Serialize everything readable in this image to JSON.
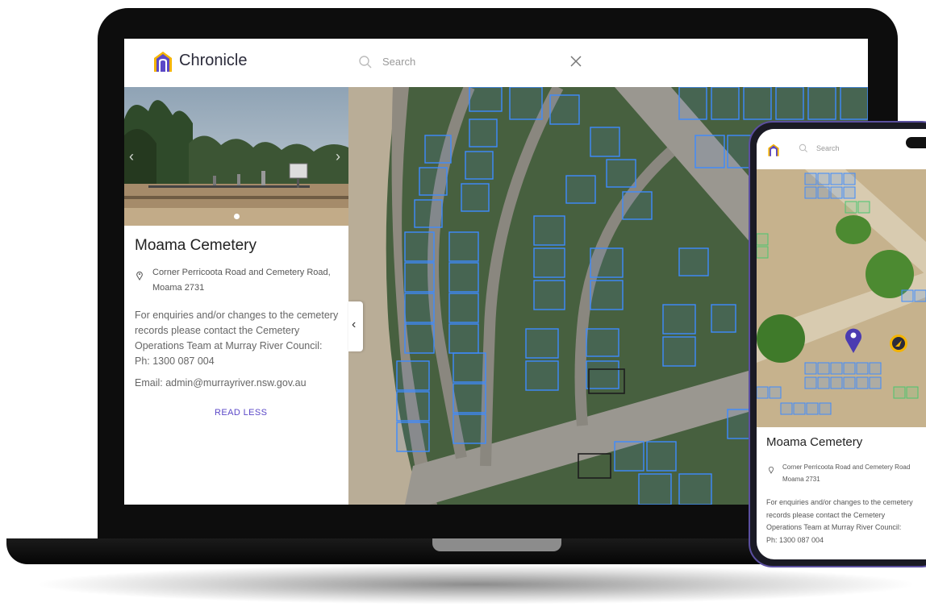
{
  "header": {
    "brand": "Chronicle",
    "search_placeholder": "Search"
  },
  "cemetery": {
    "name": "Moama Cemetery",
    "address_line1": "Corner Perricoota Road and Cemetery Road,",
    "address_line2": "Moama 2731",
    "enquiry_line1": "For enquiries and/or changes to the cemetery",
    "enquiry_line2": "records please contact the Cemetery",
    "enquiry_line3": "Operations Team at Murray River Council:",
    "phone": "Ph: 1300 087 004",
    "email": "Email: admin@murrayriver.nsw.gov.au",
    "read_less": "READ LESS"
  },
  "mobile": {
    "search_placeholder": "Search",
    "name": "Moama Cemetery",
    "address_line1": "Corner Perricoota Road and Cemetery Road",
    "address_line2": "Moama 2731",
    "enquiry_line1": "For enquiries and/or changes to the cemetery",
    "enquiry_line2": "records please contact the Cemetery",
    "enquiry_line3": "Operations Team at Murray River Council:",
    "phone": "Ph: 1300 087 004"
  },
  "colors": {
    "brand_purple": "#5b48c7",
    "plot_outline": "#3d8bff",
    "selected_plot": "#1d1d1d",
    "grass": "#47603f",
    "path": "#9a9790"
  },
  "icons": {
    "logo": "chronicle-arch-logo",
    "search": "search-icon",
    "close": "close-icon",
    "pin": "map-pin-icon",
    "collapse": "chevron-left-icon",
    "carousel_prev": "chevron-left-icon",
    "carousel_next": "chevron-right-icon"
  }
}
